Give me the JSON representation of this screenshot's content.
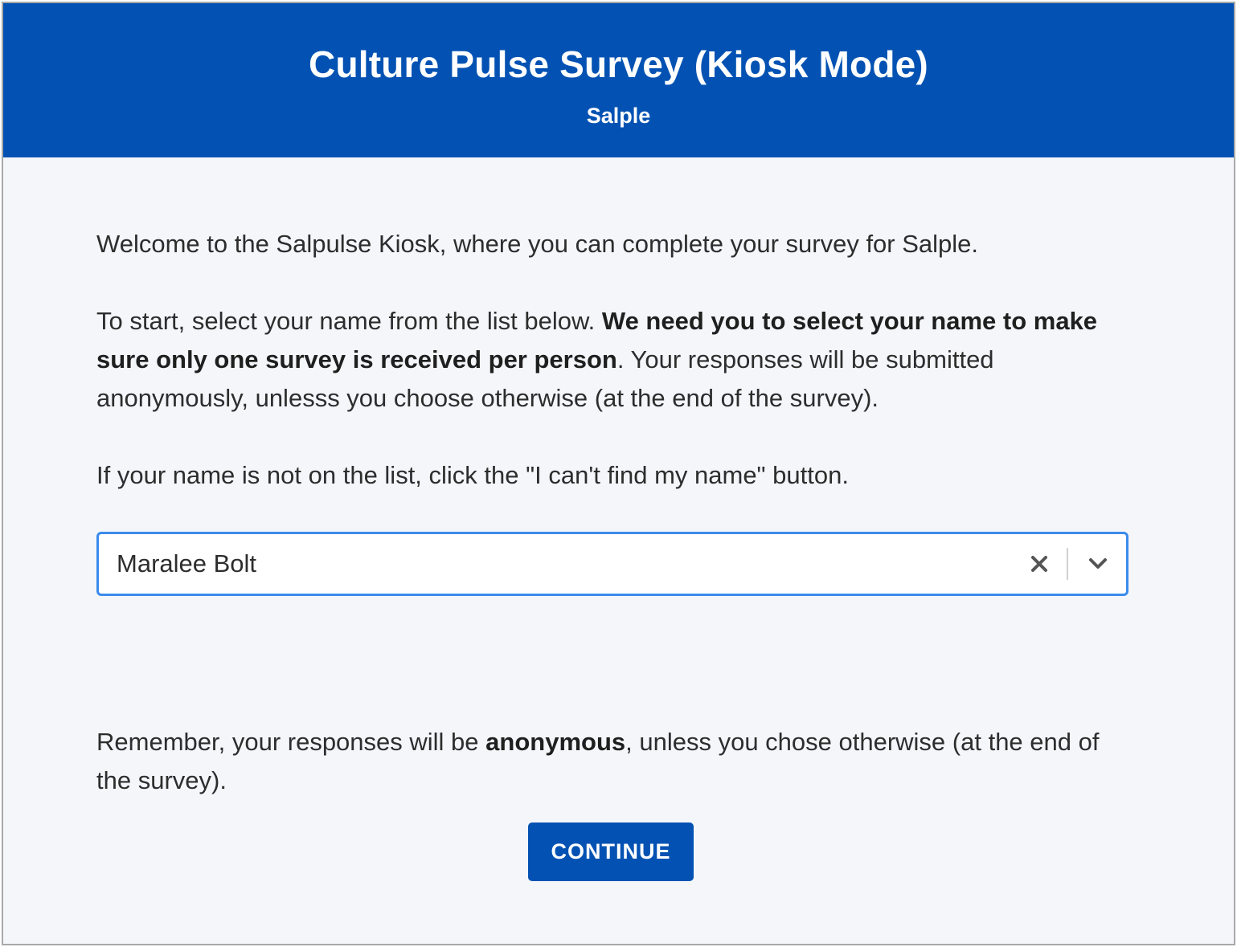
{
  "header": {
    "title": "Culture Pulse Survey (Kiosk Mode)",
    "subtitle": "Salple"
  },
  "intro": {
    "welcome": "Welcome to the Salpulse Kiosk, where you can complete your survey for Salple.",
    "instructions_start": "To start, select your name from the list below. ",
    "instructions_bold": "We need you to select your name to make sure only one survey is received per person",
    "instructions_end": ". Your responses will be submitted anonymously, unlesss you choose otherwise (at the end of the survey).",
    "not_found": "If your name is not on the list, click the \"I can't find my name\" button."
  },
  "name_select": {
    "selected_value": "Maralee Bolt",
    "clear_icon": "close-icon",
    "dropdown_icon": "chevron-down-icon"
  },
  "reminder": {
    "start": "Remember, your responses will be ",
    "bold": "anonymous",
    "end": ", unless you chose otherwise (at the end of the survey)."
  },
  "actions": {
    "continue_label": "CONTINUE"
  },
  "colors": {
    "primary": "#0352b3",
    "focus_border": "#3b8beb",
    "background": "#f4f6fa"
  }
}
